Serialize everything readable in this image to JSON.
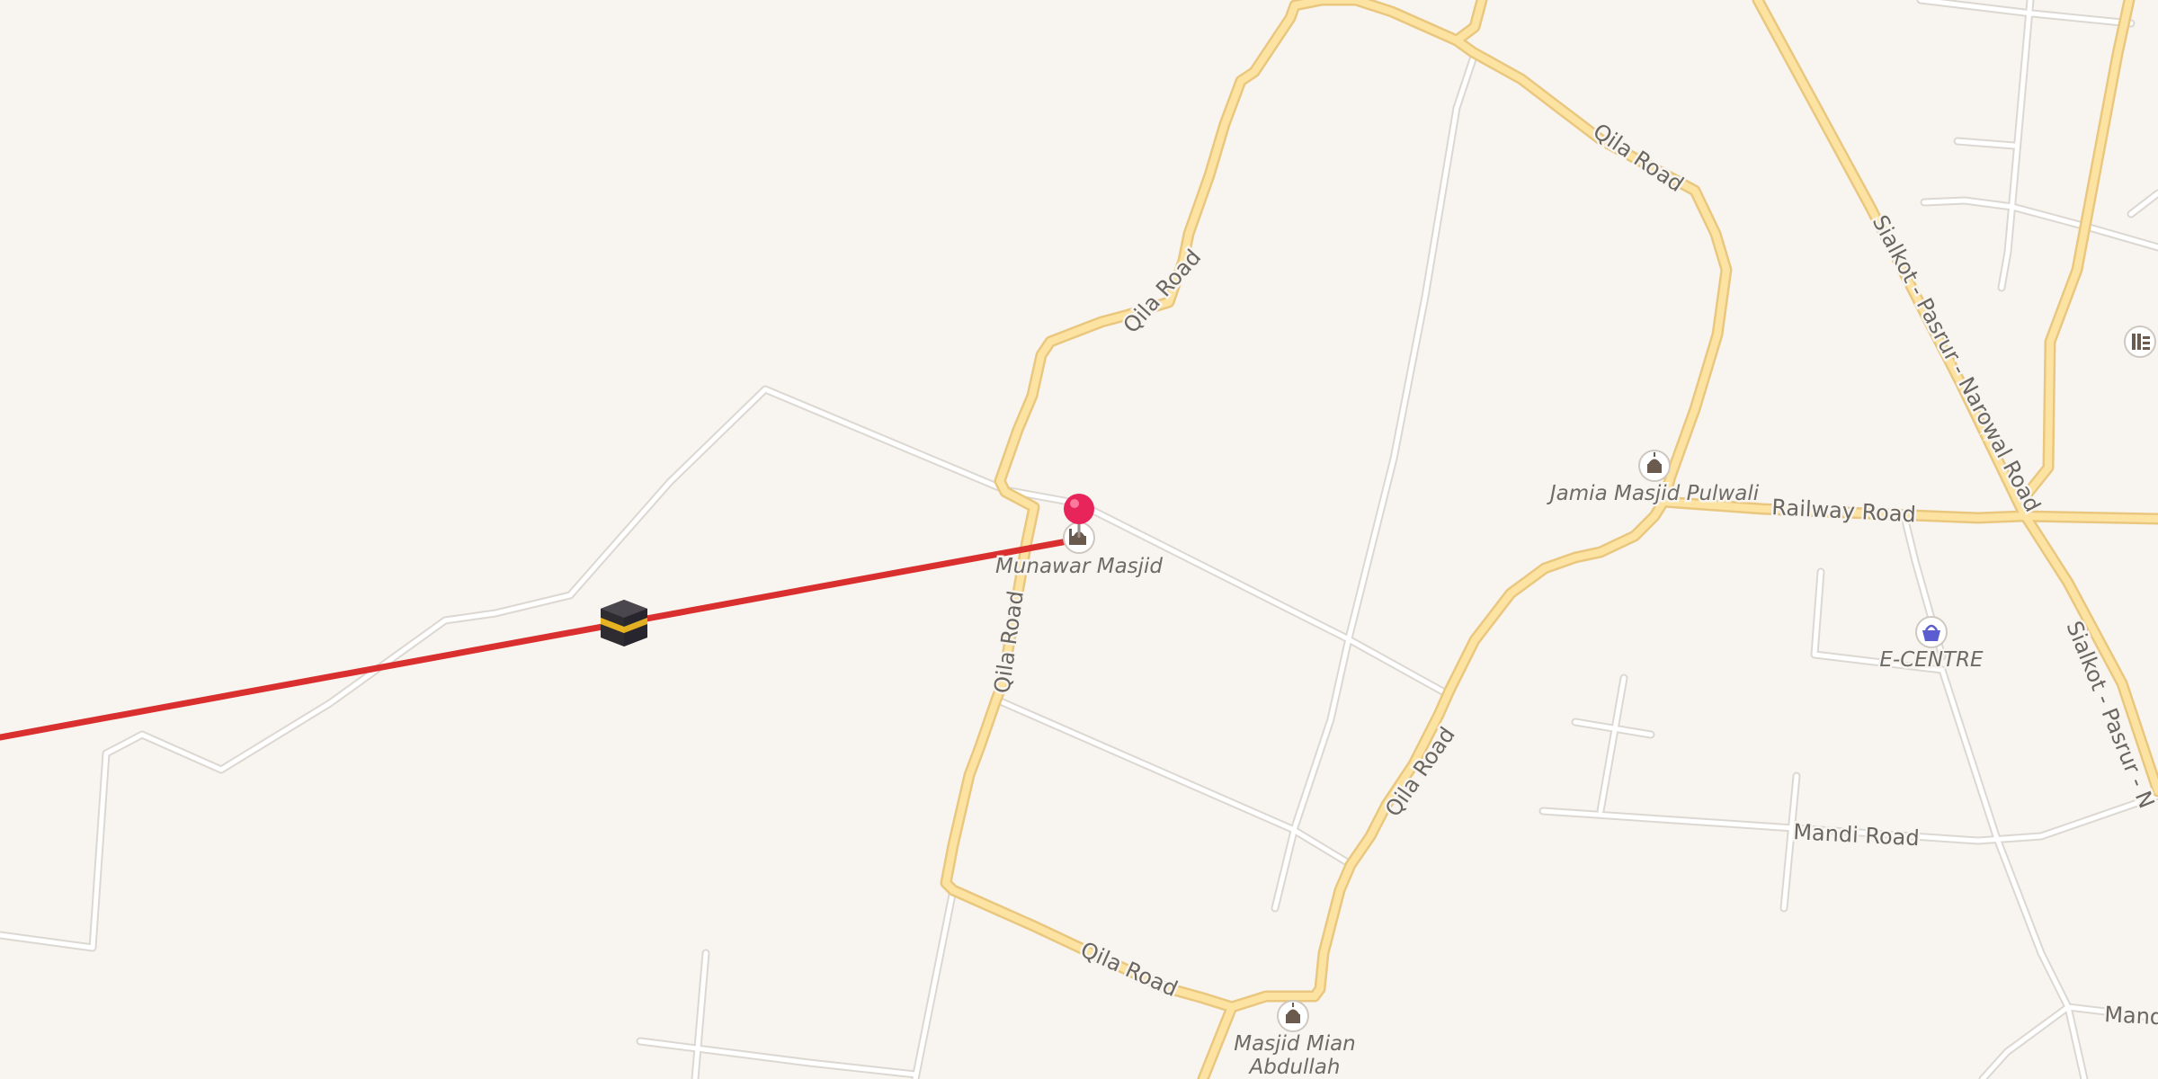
{
  "colors": {
    "background": "#f8f5f1",
    "primary_road_fill": "#fde3a2",
    "primary_road_casing": "#eac77f",
    "minor_road_fill": "#ffffff",
    "minor_road_casing": "#dcd7d1",
    "route_line": "#d9302f",
    "pin": "#e8255b",
    "poi_icon": "#6b5a4e",
    "shop_icon": "#5b5ccf"
  },
  "roads": {
    "qila_road_north": "Qila Road",
    "qila_road_northeast": "Qila Road",
    "qila_road_west": "Qila Road",
    "qila_road_south": "Qila Road",
    "qila_road_east": "Qila Road",
    "railway_road": "Railway Road",
    "sialkot_pasrur_narowal": "Sialkot - Pasrur - Narowal Road",
    "sialkot_pasrur_cut": "Sialkot - Pasrur - N",
    "mandi_road": "Mandi Road",
    "mandi_road_cut": "Mand"
  },
  "pois": {
    "munawar_masjid": {
      "label": "Munawar Masjid",
      "icon": "mosque-icon"
    },
    "jamia_masjid_pulwali": {
      "label": "Jamia Masjid Pulwali",
      "icon": "mosque-icon"
    },
    "masjid_mian_abdullah": {
      "label_line1": "Masjid Mian",
      "label_line2": "Abdullah",
      "icon": "mosque-icon"
    },
    "e_centre": {
      "label": "E-CENTRE",
      "icon": "shopping-basket-icon"
    },
    "kaaba": {
      "icon": "kaaba-icon"
    },
    "edge_poi": {
      "icon": "library-icon"
    }
  },
  "markers": {
    "location_pin": {
      "icon": "location-pin-icon"
    }
  },
  "route": {
    "type": "qibla-direction-line"
  }
}
